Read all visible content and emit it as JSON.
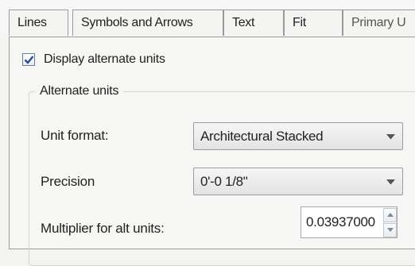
{
  "tabs": [
    {
      "label": "Lines",
      "active": true
    },
    {
      "label": "Symbols and Arrows",
      "active": false
    },
    {
      "label": "Text",
      "active": false
    },
    {
      "label": "Fit",
      "active": false
    },
    {
      "label": "Primary U",
      "active": false
    }
  ],
  "display_alternate_units": {
    "label": "Display alternate units",
    "checked": true
  },
  "alternate_units_group": {
    "title": "Alternate units",
    "unit_format": {
      "label": "Unit format:",
      "value": "Architectural Stacked"
    },
    "precision": {
      "label": "Precision",
      "value": "0'-0 1/8\""
    },
    "multiplier": {
      "label": "Multiplier for alt units:",
      "value": "0.03937000"
    }
  },
  "icons": {
    "checkmark": "checkmark-icon",
    "dropdown": "chevron-down-icon",
    "spin_up": "chevron-up-icon",
    "spin_down": "chevron-down-icon"
  },
  "colors": {
    "checkmark": "#2a4a8c",
    "border": "#9b9b9b"
  }
}
